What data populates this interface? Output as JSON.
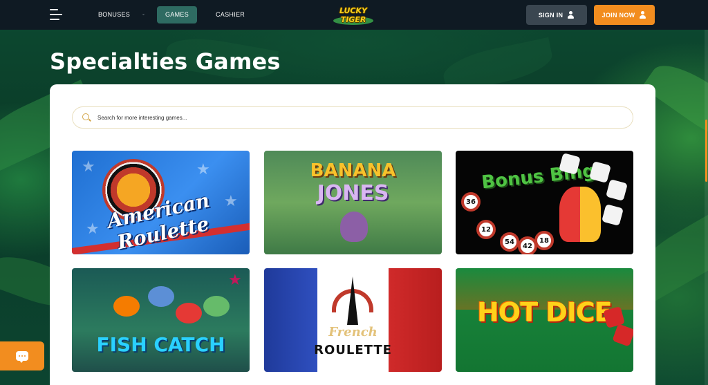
{
  "header": {
    "nav": {
      "bonuses": "BONUSES",
      "games": "GAMES",
      "cashier": "CASHIER"
    },
    "logo_text": "LUCKY TIGER",
    "sign_in": "SIGN IN",
    "join_now": "JOIN NOW"
  },
  "page": {
    "title": "Specialties Games"
  },
  "search": {
    "placeholder": "Search for more interesting games..."
  },
  "games": [
    {
      "title": "American Roulette"
    },
    {
      "title": "BANANA",
      "subtitle": "JONES"
    },
    {
      "title": "Bonus Bingo"
    },
    {
      "title": "FISH CATCH"
    },
    {
      "title": "French",
      "subtitle": "ROULETTE"
    },
    {
      "title": "HOT DICE"
    }
  ],
  "bingo_balls": [
    "36",
    "12",
    "54",
    "42",
    "18"
  ],
  "colors": {
    "accent": "#f28d1f",
    "nav_active": "#2e6b62",
    "header_bg": "#0f1a23"
  }
}
